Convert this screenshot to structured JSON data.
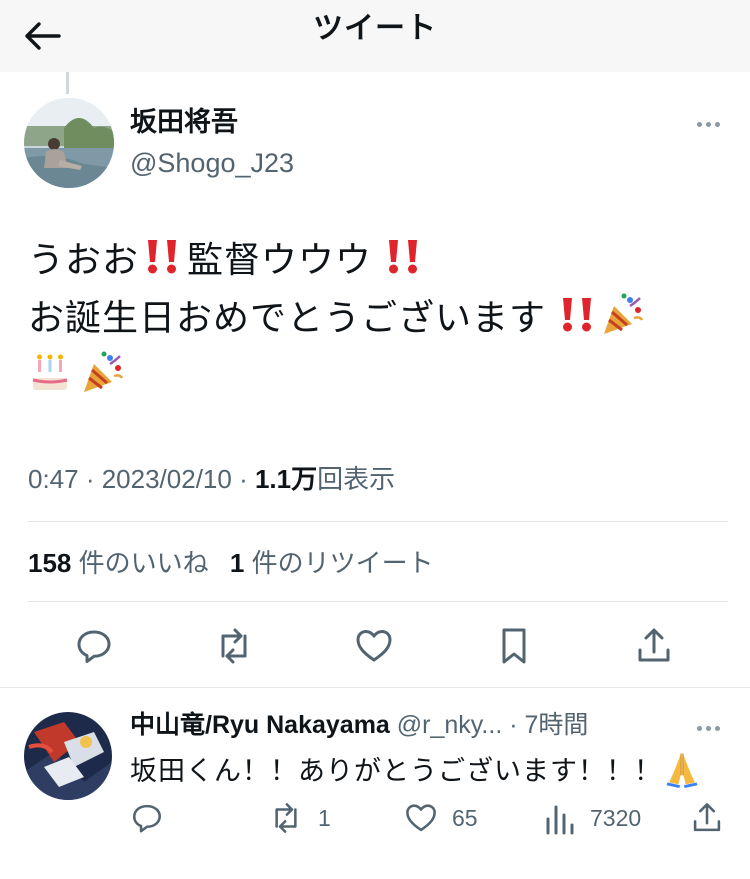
{
  "header": {
    "title": "ツイート",
    "back_icon": "arrow-left-icon"
  },
  "tweet": {
    "author_name": "坂田将吾",
    "author_handle": "@Shogo_J23",
    "text_lines": [
      "うおお",
      "監督ウウウ",
      "お誕生日おめでとうございます"
    ],
    "emojis": [
      "double-exclamation-emoji",
      "party-popper-emoji",
      "birthday-cake-emoji"
    ],
    "time": "0:47",
    "separator": " · ",
    "date": "2023/02/10",
    "views_count": "1.1万",
    "views_label": "回表示",
    "likes_count": "158",
    "likes_label": "件のいいね",
    "retweets_count": "1",
    "retweets_label": "件のリツイート"
  },
  "reply": {
    "author_name": "中山竜/Ryu Nakayama",
    "author_handle": "@r_nky...",
    "separator": " · ",
    "time": "7時間",
    "text": "坂田くん！！ありがとうございます！！！",
    "emoji": "folded-hands-emoji",
    "retweet_count": "1",
    "like_count": "65",
    "view_count": "7320"
  },
  "colors": {
    "text_primary": "#0f1419",
    "text_secondary": "#536471",
    "divider": "#e3e7ea",
    "header_bg": "#f7f7f7",
    "exclamation_red": "#e0242b"
  }
}
